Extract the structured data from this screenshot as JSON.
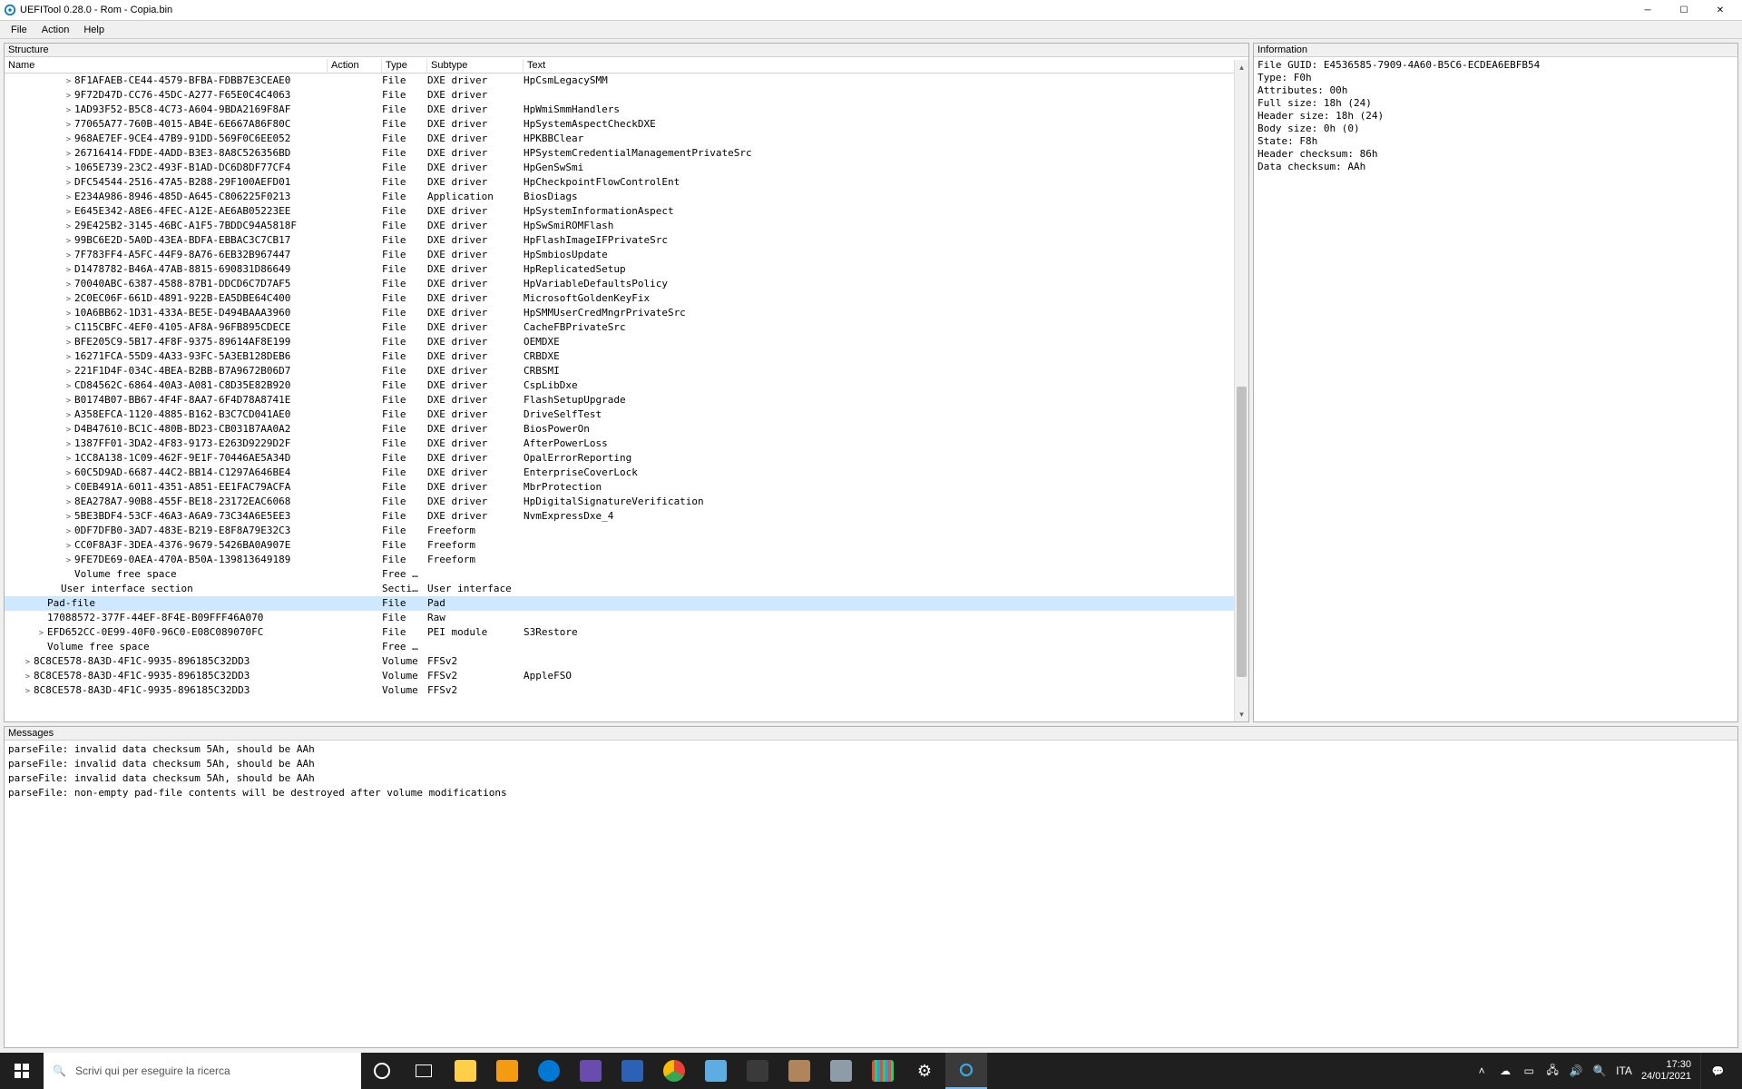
{
  "window": {
    "title": "UEFITool 0.28.0 - Rom - Copia.bin"
  },
  "menu": {
    "file": "File",
    "action": "Action",
    "help": "Help"
  },
  "panels": {
    "structure": "Structure",
    "information": "Information",
    "messages": "Messages"
  },
  "columns": {
    "name": "Name",
    "action": "Action",
    "type": "Type",
    "subtype": "Subtype",
    "text": "Text"
  },
  "tree": [
    {
      "indent": 4,
      "exp": ">",
      "name": "8F1AFAEB-CE44-4579-BFBA-FDBB7E3CEAE0",
      "type": "File",
      "subtype": "DXE driver",
      "text": "HpCsmLegacySMM"
    },
    {
      "indent": 4,
      "exp": ">",
      "name": "9F72D47D-CC76-45DC-A277-F65E0C4C4063",
      "type": "File",
      "subtype": "DXE driver",
      "text": ""
    },
    {
      "indent": 4,
      "exp": ">",
      "name": "1AD93F52-B5C8-4C73-A604-9BDA2169F8AF",
      "type": "File",
      "subtype": "DXE driver",
      "text": "HpWmiSmmHandlers"
    },
    {
      "indent": 4,
      "exp": ">",
      "name": "77065A77-760B-4015-AB4E-6E667A86F80C",
      "type": "File",
      "subtype": "DXE driver",
      "text": "HpSystemAspectCheckDXE"
    },
    {
      "indent": 4,
      "exp": ">",
      "name": "968AE7EF-9CE4-47B9-91DD-569F0C6EE052",
      "type": "File",
      "subtype": "DXE driver",
      "text": "HPKBBClear"
    },
    {
      "indent": 4,
      "exp": ">",
      "name": "26716414-FDDE-4ADD-B3E3-8A8C526356BD",
      "type": "File",
      "subtype": "DXE driver",
      "text": "HPSystemCredentialManagementPrivateSrc"
    },
    {
      "indent": 4,
      "exp": ">",
      "name": "1065E739-23C2-493F-B1AD-DC6D8DF77CF4",
      "type": "File",
      "subtype": "DXE driver",
      "text": "HpGenSwSmi"
    },
    {
      "indent": 4,
      "exp": ">",
      "name": "DFC54544-2516-47A5-B288-29F100AEFD01",
      "type": "File",
      "subtype": "DXE driver",
      "text": "HpCheckpointFlowControlEnt"
    },
    {
      "indent": 4,
      "exp": ">",
      "name": "E234A986-8946-485D-A645-C806225F0213",
      "type": "File",
      "subtype": "Application",
      "text": "BiosDiags"
    },
    {
      "indent": 4,
      "exp": ">",
      "name": "E645E342-A8E6-4FEC-A12E-AE6AB05223EE",
      "type": "File",
      "subtype": "DXE driver",
      "text": "HpSystemInformationAspect"
    },
    {
      "indent": 4,
      "exp": ">",
      "name": "29E425B2-3145-46BC-A1F5-7BDDC94A5818F",
      "type": "File",
      "subtype": "DXE driver",
      "text": "HpSwSmiROMFlash"
    },
    {
      "indent": 4,
      "exp": ">",
      "name": "99BC6E2D-5A0D-43EA-BDFA-EBBAC3C7CB17",
      "type": "File",
      "subtype": "DXE driver",
      "text": "HpFlashImageIFPrivateSrc"
    },
    {
      "indent": 4,
      "exp": ">",
      "name": "7F783FF4-A5FC-44F9-8A76-6EB32B967447",
      "type": "File",
      "subtype": "DXE driver",
      "text": "HpSmbiosUpdate"
    },
    {
      "indent": 4,
      "exp": ">",
      "name": "D1478782-B46A-47AB-8815-690831D86649",
      "type": "File",
      "subtype": "DXE driver",
      "text": "HpReplicatedSetup"
    },
    {
      "indent": 4,
      "exp": ">",
      "name": "70040ABC-6387-4588-87B1-DDCD6C7D7AF5",
      "type": "File",
      "subtype": "DXE driver",
      "text": "HpVariableDefaultsPolicy"
    },
    {
      "indent": 4,
      "exp": ">",
      "name": "2C0EC06F-661D-4891-922B-EA5DBE64C400",
      "type": "File",
      "subtype": "DXE driver",
      "text": "MicrosoftGoldenKeyFix"
    },
    {
      "indent": 4,
      "exp": ">",
      "name": "10A6BB62-1D31-433A-BE5E-D494BAAA3960",
      "type": "File",
      "subtype": "DXE driver",
      "text": "HpSMMUserCredMngrPrivateSrc"
    },
    {
      "indent": 4,
      "exp": ">",
      "name": "C115CBFC-4EF0-4105-AF8A-96FB895CDECE",
      "type": "File",
      "subtype": "DXE driver",
      "text": "CacheFBPrivateSrc"
    },
    {
      "indent": 4,
      "exp": ">",
      "name": "BFE205C9-5B17-4F8F-9375-89614AF8E199",
      "type": "File",
      "subtype": "DXE driver",
      "text": "OEMDXE"
    },
    {
      "indent": 4,
      "exp": ">",
      "name": "16271FCA-55D9-4A33-93FC-5A3EB128DEB6",
      "type": "File",
      "subtype": "DXE driver",
      "text": "CRBDXE"
    },
    {
      "indent": 4,
      "exp": ">",
      "name": "221F1D4F-034C-4BEA-B2BB-B7A9672B06D7",
      "type": "File",
      "subtype": "DXE driver",
      "text": "CRBSMI"
    },
    {
      "indent": 4,
      "exp": ">",
      "name": "CD84562C-6864-40A3-A081-C8D35E82B920",
      "type": "File",
      "subtype": "DXE driver",
      "text": "CspLibDxe"
    },
    {
      "indent": 4,
      "exp": ">",
      "name": "B0174B07-BB67-4F4F-8AA7-6F4D78A8741E",
      "type": "File",
      "subtype": "DXE driver",
      "text": "FlashSetupUpgrade"
    },
    {
      "indent": 4,
      "exp": ">",
      "name": "A358EFCA-1120-4885-B162-B3C7CD041AE0",
      "type": "File",
      "subtype": "DXE driver",
      "text": "DriveSelfTest"
    },
    {
      "indent": 4,
      "exp": ">",
      "name": "D4B47610-BC1C-480B-BD23-CB031B7AA0A2",
      "type": "File",
      "subtype": "DXE driver",
      "text": "BiosPowerOn"
    },
    {
      "indent": 4,
      "exp": ">",
      "name": "1387FF01-3DA2-4F83-9173-E263D9229D2F",
      "type": "File",
      "subtype": "DXE driver",
      "text": "AfterPowerLoss"
    },
    {
      "indent": 4,
      "exp": ">",
      "name": "1CC8A138-1C09-462F-9E1F-70446AE5A34D",
      "type": "File",
      "subtype": "DXE driver",
      "text": "OpalErrorReporting"
    },
    {
      "indent": 4,
      "exp": ">",
      "name": "60C5D9AD-6687-44C2-BB14-C1297A646BE4",
      "type": "File",
      "subtype": "DXE driver",
      "text": "EnterpriseCoverLock"
    },
    {
      "indent": 4,
      "exp": ">",
      "name": "C0EB491A-6011-4351-A851-EE1FAC79ACFA",
      "type": "File",
      "subtype": "DXE driver",
      "text": "MbrProtection"
    },
    {
      "indent": 4,
      "exp": ">",
      "name": "8EA278A7-90B8-455F-BE18-23172EAC6068",
      "type": "File",
      "subtype": "DXE driver",
      "text": "HpDigitalSignatureVerification"
    },
    {
      "indent": 4,
      "exp": ">",
      "name": "5BE3BDF4-53CF-46A3-A6A9-73C34A6E5EE3",
      "type": "File",
      "subtype": "DXE driver",
      "text": "NvmExpressDxe_4"
    },
    {
      "indent": 4,
      "exp": ">",
      "name": "0DF7DFB0-3AD7-483E-B219-E8F8A79E32C3",
      "type": "File",
      "subtype": "Freeform",
      "text": ""
    },
    {
      "indent": 4,
      "exp": ">",
      "name": "CC0F8A3F-3DEA-4376-9679-5426BA0A907E",
      "type": "File",
      "subtype": "Freeform",
      "text": ""
    },
    {
      "indent": 4,
      "exp": ">",
      "name": "9FE7DE69-0AEA-470A-B50A-139813649189",
      "type": "File",
      "subtype": "Freeform",
      "text": ""
    },
    {
      "indent": 4,
      "exp": "",
      "name": "Volume free space",
      "type": "Free …",
      "subtype": "",
      "text": ""
    },
    {
      "indent": 3,
      "exp": "",
      "name": "User interface section",
      "type": "Secti…",
      "subtype": "User interface",
      "text": ""
    },
    {
      "indent": 2,
      "exp": "",
      "name": "Pad-file",
      "type": "File",
      "subtype": "Pad",
      "text": "",
      "selected": true
    },
    {
      "indent": 2,
      "exp": "",
      "name": "17088572-377F-44EF-8F4E-B09FFF46A070",
      "type": "File",
      "subtype": "Raw",
      "text": ""
    },
    {
      "indent": 2,
      "exp": ">",
      "name": "EFD652CC-0E99-40F0-96C0-E08C089070FC",
      "type": "File",
      "subtype": "PEI module",
      "text": "S3Restore"
    },
    {
      "indent": 2,
      "exp": "",
      "name": "Volume free space",
      "type": "Free …",
      "subtype": "",
      "text": ""
    },
    {
      "indent": 1,
      "exp": ">",
      "name": "8C8CE578-8A3D-4F1C-9935-896185C32DD3",
      "type": "Volume",
      "subtype": "FFSv2",
      "text": ""
    },
    {
      "indent": 1,
      "exp": ">",
      "name": "8C8CE578-8A3D-4F1C-9935-896185C32DD3",
      "type": "Volume",
      "subtype": "FFSv2",
      "text": "AppleFSO"
    },
    {
      "indent": 1,
      "exp": ">",
      "name": "8C8CE578-8A3D-4F1C-9935-896185C32DD3",
      "type": "Volume",
      "subtype": "FFSv2",
      "text": ""
    }
  ],
  "info": {
    "lines": [
      "File GUID: E4536585-7909-4A60-B5C6-ECDEA6EBFB54",
      "Type: F0h",
      "Attributes: 00h",
      "Full size: 18h (24)",
      "Header size: 18h (24)",
      "Body size: 0h (0)",
      "State: F8h",
      "Header checksum: 86h",
      "Data checksum: AAh"
    ]
  },
  "messages": [
    "parseFile: invalid data checksum 5Ah, should be AAh",
    "parseFile: invalid data checksum 5Ah, should be AAh",
    "parseFile: invalid data checksum 5Ah, should be AAh",
    "parseFile: non-empty pad-file contents will be destroyed after volume modifications"
  ],
  "taskbar": {
    "searchPlaceholder": "Scrivi qui per eseguire la ricerca",
    "lang": "ITA",
    "time": "17:30",
    "date": "24/01/2021"
  }
}
